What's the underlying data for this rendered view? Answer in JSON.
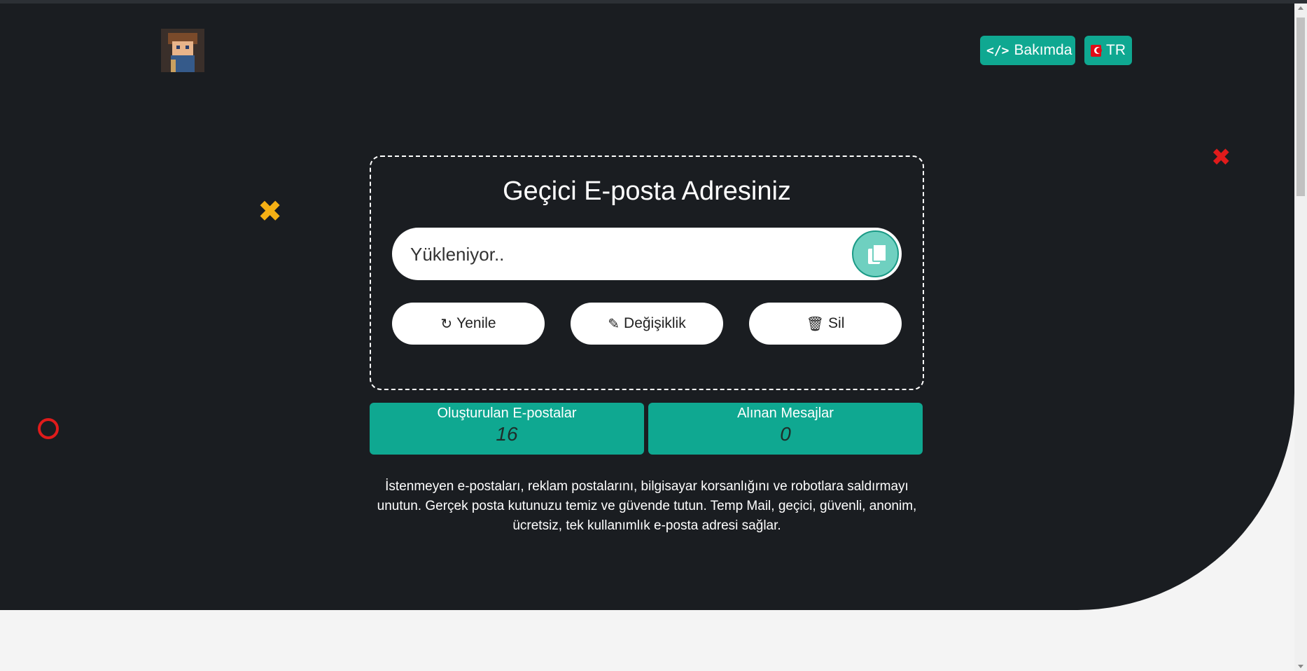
{
  "header": {
    "maintenance_label": "Bakımda",
    "language_label": "TR"
  },
  "card": {
    "title": "Geçici E-posta Adresiniz",
    "email_placeholder": "Yükleniyor..",
    "actions": {
      "refresh": "Yenile",
      "change": "Değişiklik",
      "delete": "Sil"
    }
  },
  "stats": {
    "created_label": "Oluşturulan E-postalar",
    "created_value": "16",
    "received_label": "Alınan Mesajlar",
    "received_value": "0"
  },
  "description": "İstenmeyen e-postaları, reklam postalarını, bilgisayar korsanlığını ve robotlara saldırmayı unutun. Gerçek posta kutunuzu temiz ve güvende tutun. Temp Mail, geçici, güvenli, anonim, ücretsiz, tek kullanımlık e-posta adresi sağlar.",
  "icons": {
    "maintenance": "code-icon",
    "language": "turkey-flag-icon",
    "copy": "copy-icon",
    "refresh": "refresh-icon",
    "change": "pencil-icon",
    "delete": "trash-icon"
  },
  "colors": {
    "background": "#1a1d21",
    "accent": "#0fa891",
    "page": "#f4f4f4"
  }
}
